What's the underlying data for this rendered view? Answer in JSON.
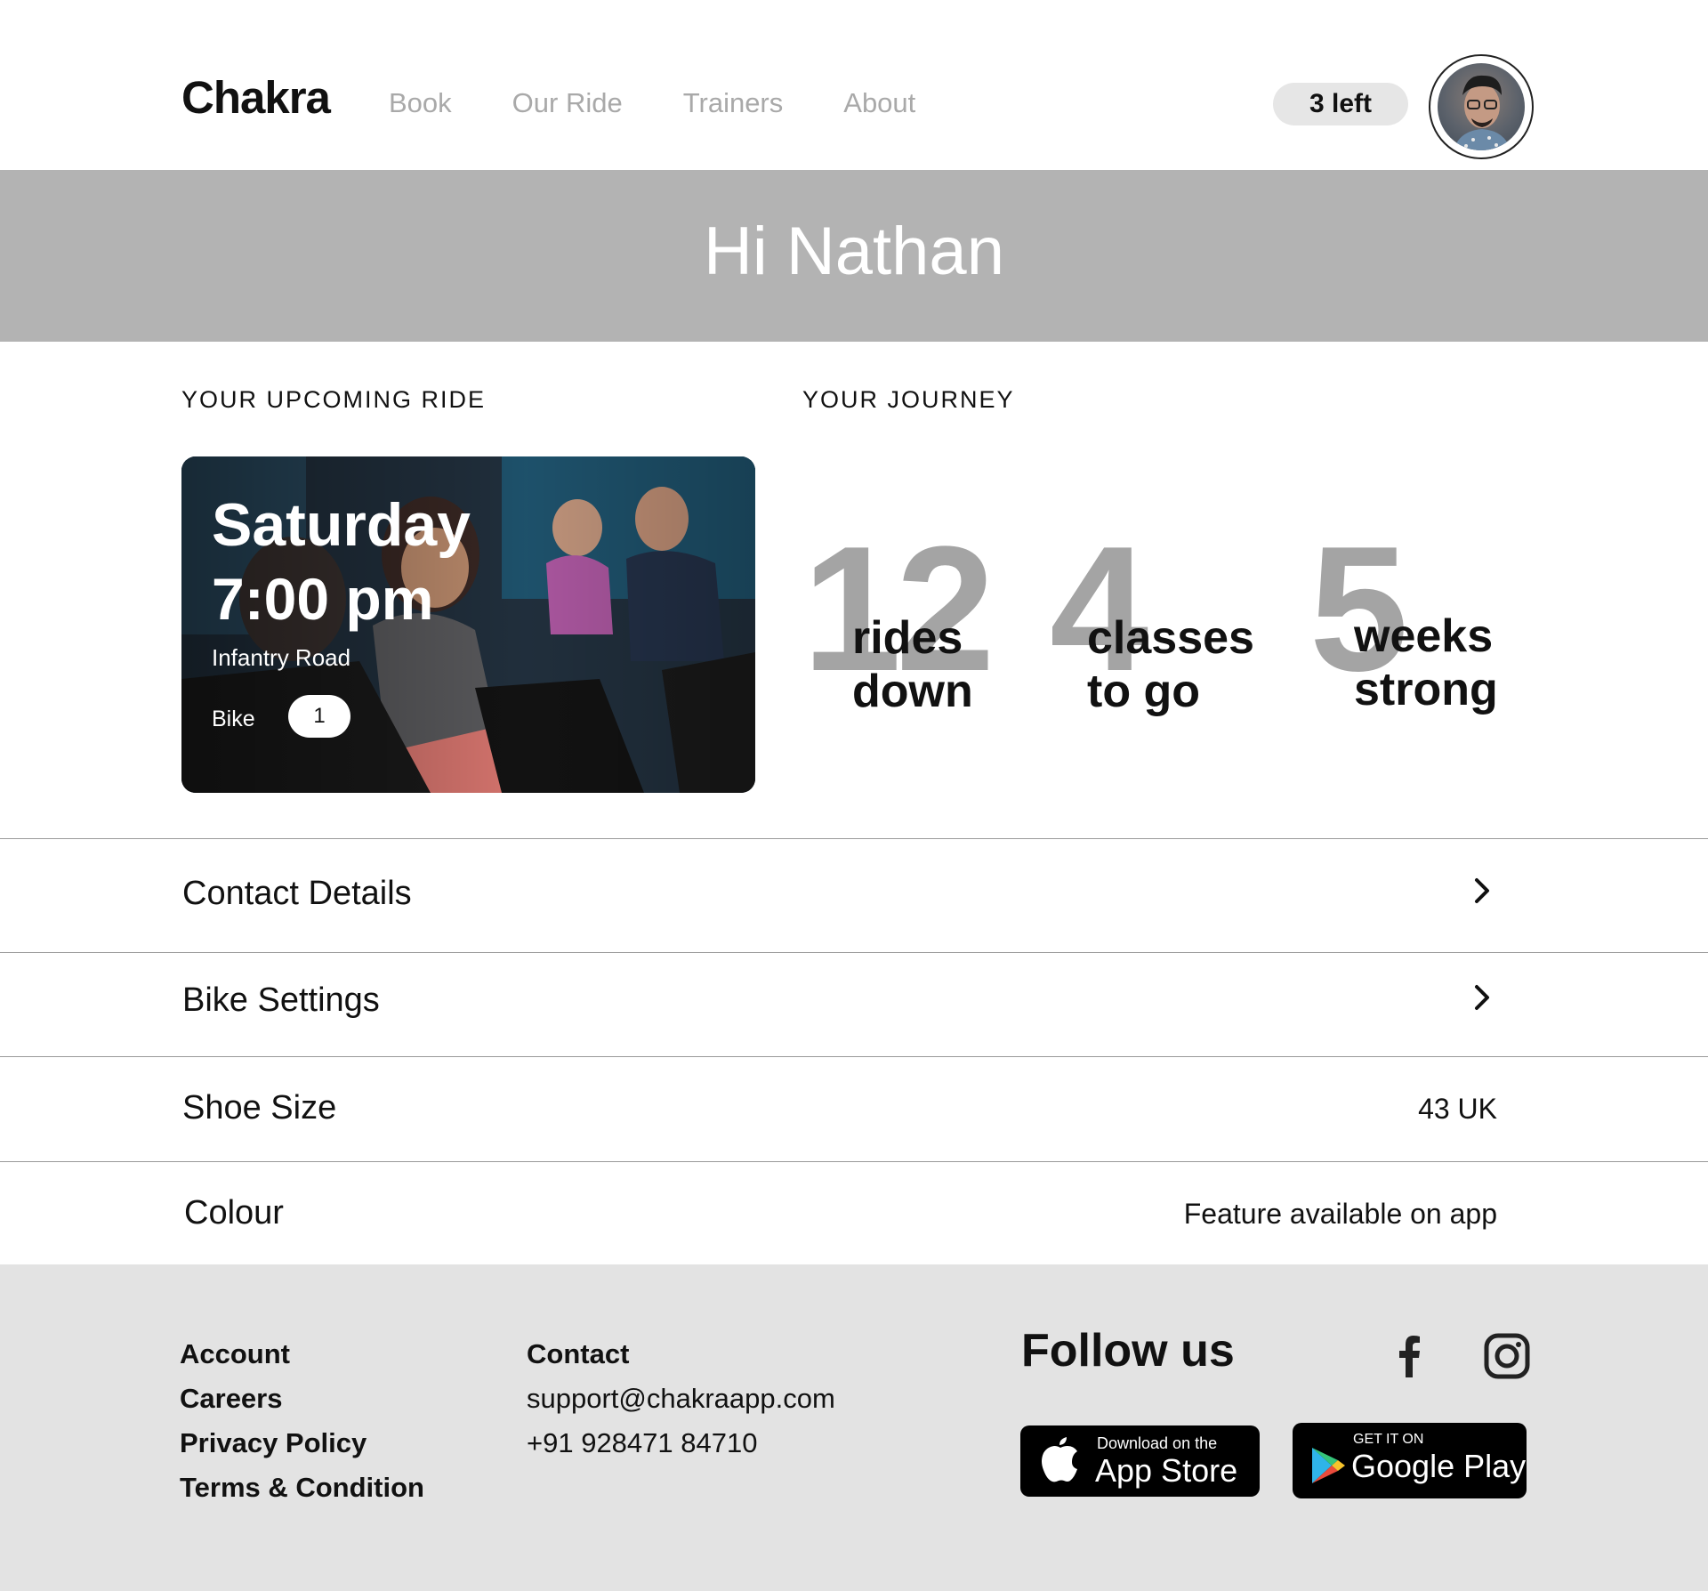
{
  "header": {
    "logo": "Chakra",
    "nav": [
      "Book",
      "Our Ride",
      "Trainers",
      "About"
    ],
    "credits": "3 left"
  },
  "banner": {
    "greeting": "Hi Nathan"
  },
  "upcoming": {
    "label": "YOUR UPCOMING RIDE",
    "day": "Saturday",
    "time": "7:00 pm",
    "location": "Infantry Road",
    "bike_label": "Bike",
    "bike_number": "1"
  },
  "journey": {
    "label": "YOUR JOURNEY",
    "stats": [
      {
        "value": "12",
        "line1": "rides",
        "line2": "down"
      },
      {
        "value": "4",
        "line1": "classes",
        "line2": "to go"
      },
      {
        "value": "5",
        "line1": "weeks",
        "line2": "strong"
      }
    ]
  },
  "settings": [
    {
      "name": "Contact Details",
      "value": ""
    },
    {
      "name": "Bike Settings",
      "value": ""
    },
    {
      "name": "Shoe Size",
      "value": "43 UK"
    },
    {
      "name": "Colour",
      "value": "Feature available on app"
    }
  ],
  "footer": {
    "links": [
      "Account",
      "Careers",
      "Privacy Policy",
      "Terms & Condition"
    ],
    "contact_heading": "Contact",
    "email": "support@chakraapp.com",
    "phone": "+91 928471 84710",
    "follow": "Follow us",
    "app_store_small": "Download on the",
    "app_store_big": "App Store",
    "play_small": "GET IT ON",
    "play_big": "Google Play",
    "icons": [
      "facebook-icon",
      "instagram-icon",
      "apple-icon",
      "google-play-icon"
    ]
  },
  "colors": {
    "banner": "#b3b3b3",
    "nav_text": "#a9a9a9",
    "stat_number": "#a4a4a4",
    "footer_bg": "#e3e3e3",
    "pill_bg": "#e6e6e6"
  }
}
